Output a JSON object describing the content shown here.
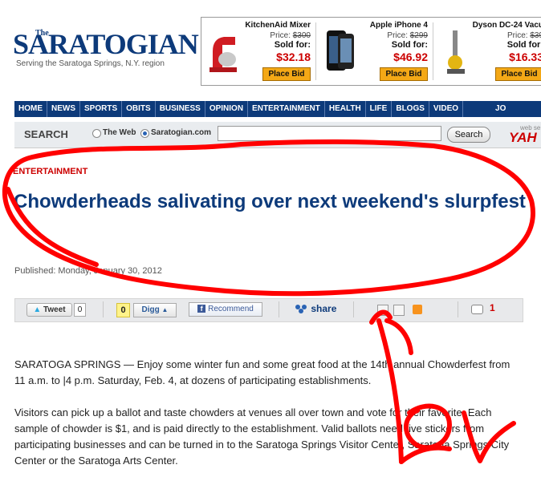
{
  "masthead": {
    "logo_small": "The",
    "logo": "SARATOGIAN",
    "tagline": "Serving the Saratoga Springs, N.Y. region"
  },
  "ads": [
    {
      "name": "KitchenAid Mixer",
      "price": "Price:",
      "old_price": "$300",
      "sold_for": "Sold for:",
      "bid": "$32.18",
      "button": "Place Bid",
      "icon": "mixer-icon"
    },
    {
      "name": "Apple iPhone 4",
      "price": "Price:",
      "old_price": "$299",
      "sold_for": "Sold for:",
      "bid": "$46.92",
      "button": "Place Bid",
      "icon": "phone-icon"
    },
    {
      "name": "Dyson DC-24 Vacu",
      "price": "Price:",
      "old_price": "$39",
      "sold_for": "Sold for:",
      "bid": "$16.33",
      "button": "Place Bid",
      "icon": "vacuum-icon"
    }
  ],
  "nav": [
    "HOME",
    "NEWS",
    "SPORTS",
    "OBITS",
    "BUSINESS",
    "OPINION",
    "ENTERTAINMENT",
    "HEALTH",
    "LIFE",
    "BLOGS",
    "VIDEO",
    "JO"
  ],
  "search": {
    "label": "SEARCH",
    "option_web": "The Web",
    "option_site": "Saratogian.com",
    "selected": "Saratogian.com",
    "value": "",
    "button": "Search",
    "provider_small": "web se",
    "provider": "YAH"
  },
  "article": {
    "section": "ENTERTAINMENT",
    "headline": "Chowderheads salivating over next weekend's slurpfest",
    "published": "Published: Monday, January 30, 2012",
    "paragraphs": [
      "SARATOGA SPRINGS — Enjoy some winter fun and some great food at the 14th annual Chowderfest from 11 a.m. to |4 p.m. Saturday, Feb. 4, at dozens of participating establishments.",
      "Visitors can pick up a ballot and taste chowders at venues all over town and vote for their favorite. Each sample of chowder is $1, and is paid directly to the establishment. Valid ballots need five stickers from participating businesses and can be turned in to the Saratoga Springs Visitor Center, Saratoga Springs City Center or the Saratoga Arts Center."
    ]
  },
  "share": {
    "tweet": "Tweet",
    "tweet_count": "0",
    "digg_count": "0",
    "digg": "Digg",
    "recommend": "Recommend",
    "share": "share",
    "comment_count": "1"
  },
  "colors": {
    "brand_blue": "#0d3a7a",
    "accent_red": "#cc0000",
    "scribble_red": "#ff0000"
  }
}
